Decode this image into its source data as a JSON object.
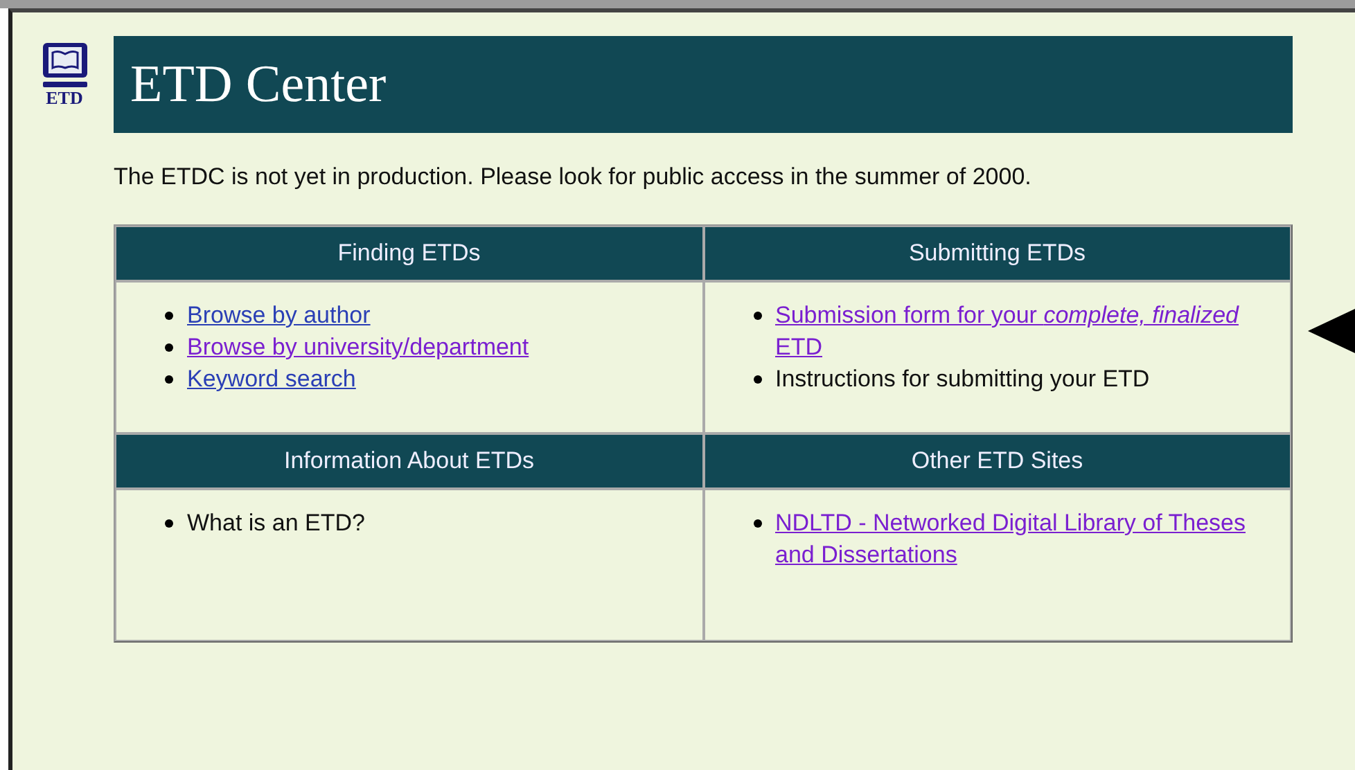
{
  "logo": {
    "text": "ETD"
  },
  "banner": {
    "title": "ETD Center"
  },
  "notice": "The ETDC is not yet in production. Please look for public access in the summer of 2000.",
  "sections": [
    {
      "heading": "Finding ETDs",
      "items": [
        {
          "kind": "link",
          "text": "Browse by author",
          "visited": false
        },
        {
          "kind": "link",
          "text": "Browse by university/department",
          "visited": true
        },
        {
          "kind": "link",
          "text": "Keyword search",
          "visited": false
        }
      ]
    },
    {
      "heading": "Submitting ETDs",
      "items": [
        {
          "kind": "link",
          "text": "Submission form for your *complete, finalized* ETD",
          "visited": true
        },
        {
          "kind": "text",
          "text": "Instructions for submitting your ETD"
        }
      ]
    },
    {
      "heading": "Information About ETDs",
      "items": [
        {
          "kind": "text",
          "text": "What is an ETD?"
        }
      ]
    },
    {
      "heading": "Other ETD Sites",
      "items": [
        {
          "kind": "link",
          "text": "NDLTD - Networked Digital Library of Theses and Dissertations",
          "visited": true
        }
      ]
    }
  ]
}
